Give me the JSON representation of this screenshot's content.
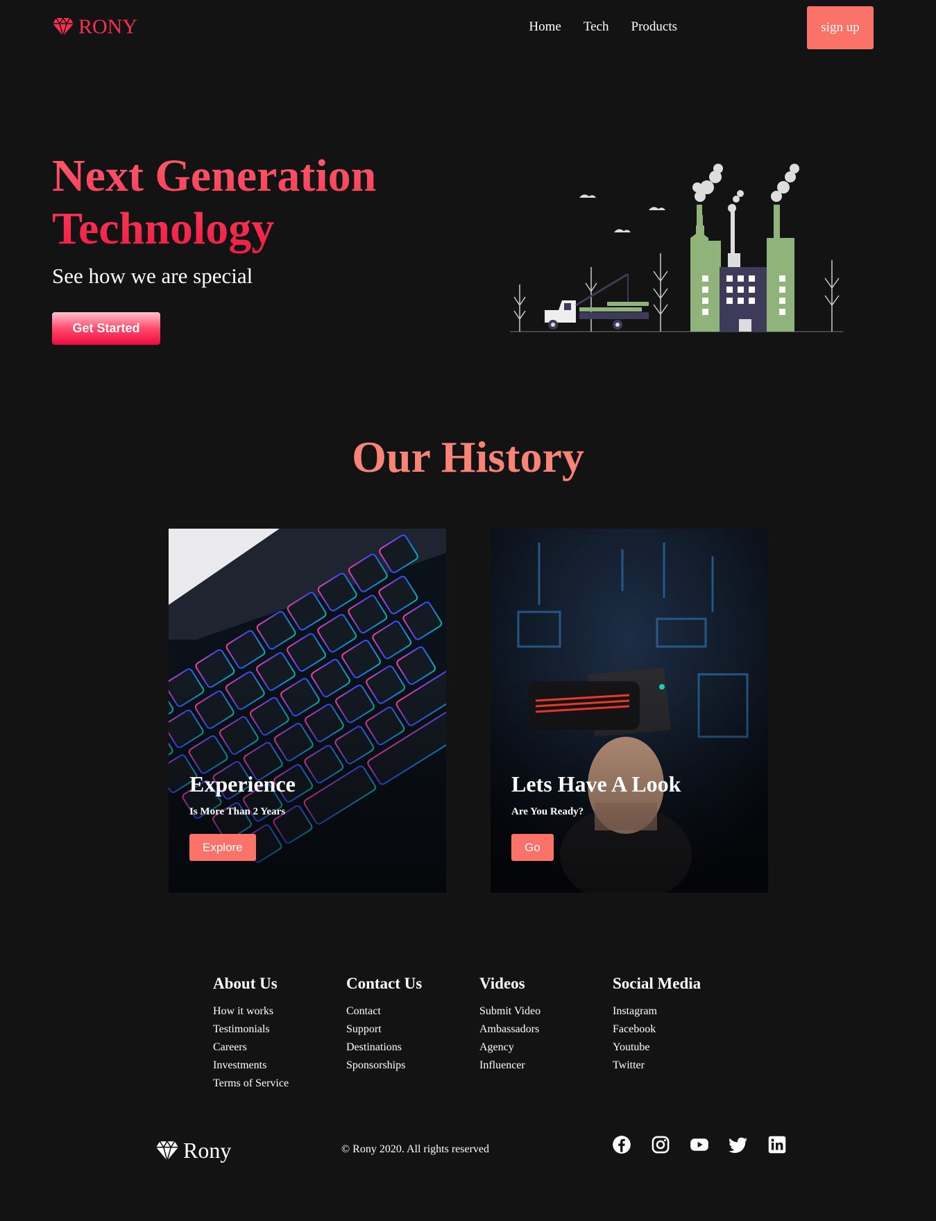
{
  "nav": {
    "brand": "RONY",
    "links": [
      "Home",
      "Tech",
      "Products"
    ],
    "signup_label": "sign up"
  },
  "hero": {
    "title_line1": "Next Generation",
    "title_line2": "Technology",
    "subtitle": "See how we are special",
    "cta_label": "Get Started"
  },
  "history": {
    "title": "Our History",
    "cards": [
      {
        "title": "Experience",
        "subtitle": "Is More Than 2 Years",
        "button": "Explore"
      },
      {
        "title": "Lets Have A Look",
        "subtitle": "Are You Ready?",
        "button": "Go"
      }
    ]
  },
  "footer": {
    "columns": [
      {
        "heading": "About Us",
        "links": [
          "How it works",
          "Testimonials",
          "Careers",
          "Investments",
          "Terms of Service"
        ]
      },
      {
        "heading": "Contact Us",
        "links": [
          "Contact",
          "Support",
          "Destinations",
          "Sponsorships"
        ]
      },
      {
        "heading": "Videos",
        "links": [
          "Submit Video",
          "Ambassadors",
          "Agency",
          "Influencer"
        ]
      },
      {
        "heading": "Social Media",
        "links": [
          "Instagram",
          "Facebook",
          "Youtube",
          "Twitter"
        ]
      }
    ],
    "brand": "Rony",
    "copyright": "© Rony 2020. All rights reserved",
    "social_icons": [
      "facebook-icon",
      "instagram-icon",
      "youtube-icon",
      "twitter-icon",
      "linkedin-icon"
    ]
  },
  "colors": {
    "background": "#131313",
    "brand_red": "#f6304f",
    "accent_coral": "#fa7268",
    "history_title": "#f88377",
    "factory_green": "#8fb37a",
    "factory_navy": "#3e3b5a"
  }
}
